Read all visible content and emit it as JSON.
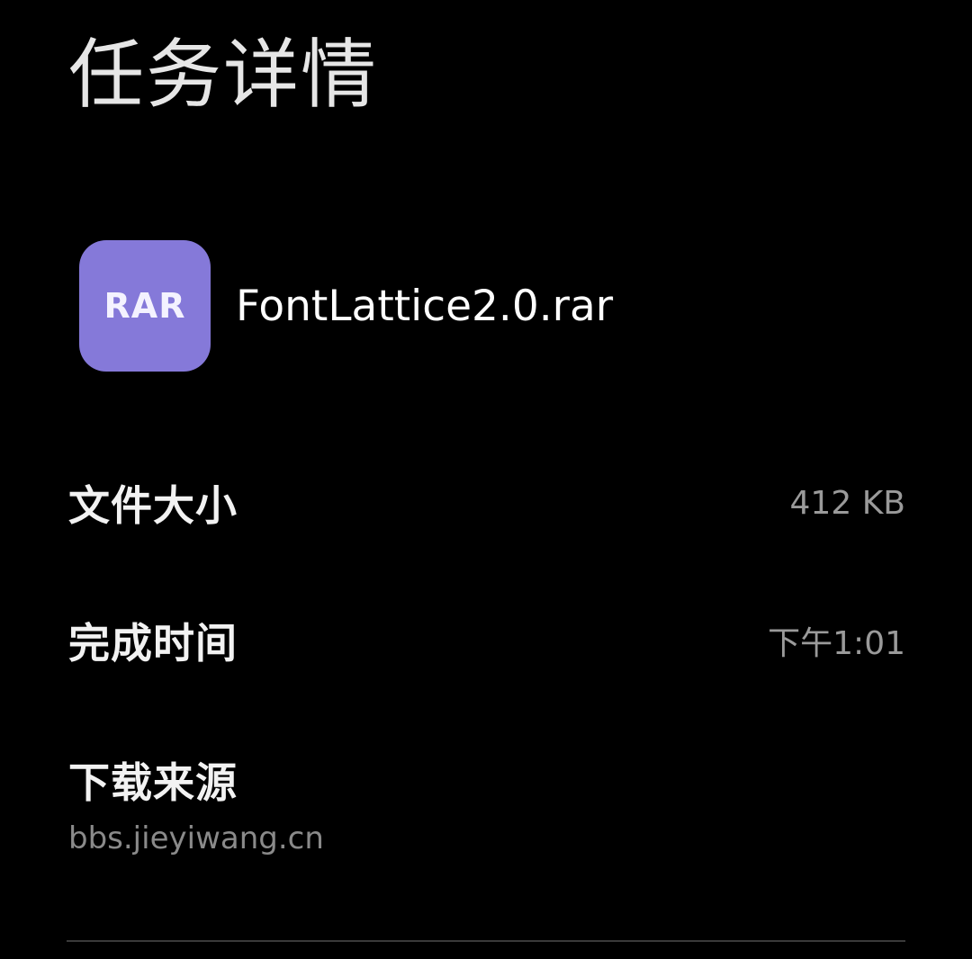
{
  "header": {
    "title": "任务详情"
  },
  "file": {
    "icon_label": "RAR",
    "icon_color": "#8579d9",
    "name": "FontLattice2.0.rar"
  },
  "details": {
    "size_label": "文件大小",
    "size_value": "412 KB",
    "time_label": "完成时间",
    "time_value": "下午1:01",
    "source_label": "下载来源",
    "source_value": "bbs.jieyiwang.cn"
  }
}
